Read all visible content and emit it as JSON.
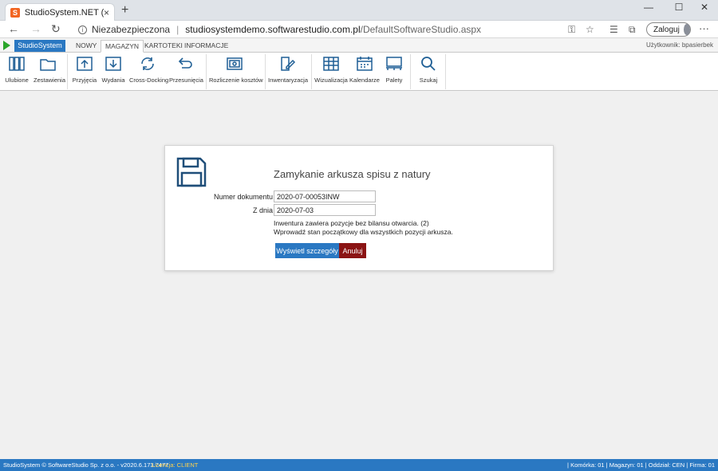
{
  "browser": {
    "tab_title": "StudioSystem.NET (c) SoftwareSt",
    "tab_favicon": "S",
    "close_tab": "×",
    "new_tab": "+",
    "security_label": "Niezabezpieczona",
    "url_host": "studiosystemdemo.softwarestudio.com.pl",
    "url_path": "/DefaultSoftwareStudio.aspx",
    "login_label": "Zaloguj",
    "more": "···",
    "window_controls": [
      "—",
      "☐",
      "✕"
    ]
  },
  "app": {
    "app_button": "StudioSystem",
    "menu_tabs": [
      "NOWY",
      "MAGAZYN",
      "KARTOTEKI",
      "INFORMACJE"
    ],
    "active_tab": "MAGAZYN",
    "user_info": "Użytkownik: bpasierbek",
    "ribbon": [
      {
        "label": "Ulubione",
        "icon": "books-icon"
      },
      {
        "label": "Zestawienia",
        "icon": "folder-icon"
      },
      {
        "label": "Przyjęcia",
        "icon": "upload-icon"
      },
      {
        "label": "Wydania",
        "icon": "download-icon"
      },
      {
        "label": "Cross-Docking",
        "icon": "refresh-icon"
      },
      {
        "label": "Przesunięcia",
        "icon": "undo-arrow-icon"
      },
      {
        "label": "Rozliczenie kosztów",
        "icon": "cash-icon"
      },
      {
        "label": "Inwentaryzacja",
        "icon": "edit-doc-icon"
      },
      {
        "label": "Wizualizacja",
        "icon": "shelves-icon"
      },
      {
        "label": "Kalendarze",
        "icon": "calendar-icon"
      },
      {
        "label": "Palety",
        "icon": "pallet-icon"
      },
      {
        "label": "Szukaj",
        "icon": "search-icon"
      }
    ]
  },
  "dialog": {
    "title": "Zamykanie arkusza spisu z natury",
    "doc_number_label": "Numer dokumentu",
    "doc_number_value": "2020-07-00053INW",
    "date_label": "Z dnia",
    "date_value": "2020-07-03",
    "message_line1": "Inwentura zawiera pozycje bez bilansu otwarcia. (2)",
    "message_line2": "Wprowadź stan początkowy dla wszystkich pozycji arkusza.",
    "details_button": "Wyświetl szczegóły",
    "cancel_button": "Anuluj"
  },
  "status": {
    "left": "StudioSystem © SoftwareStudio Sp. z o.o. - v2020.6.173.7477",
    "license": "Licencja: CLIENT",
    "right": "| Komórka: 01 | Magazyn: 01 | Oddział: CEN | Firma: 01"
  },
  "colors": {
    "accent": "#2a78c2",
    "cancel": "#8b1414",
    "license": "#ffd24d"
  }
}
